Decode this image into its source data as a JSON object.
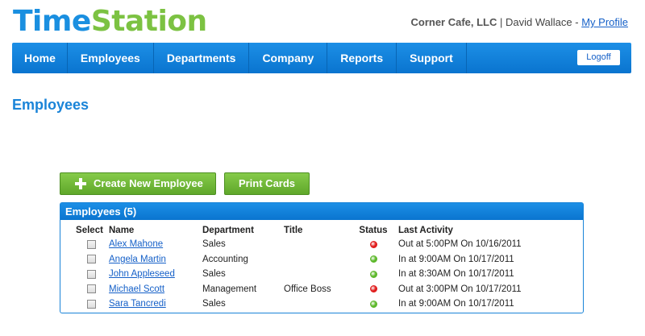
{
  "logo": {
    "part1": "Time",
    "part2": "Station"
  },
  "account": {
    "company": "Corner Cafe, LLC",
    "separator": "|",
    "user": "David Wallace -",
    "profile_link": "My Profile"
  },
  "nav": {
    "items": [
      "Home",
      "Employees",
      "Departments",
      "Company",
      "Reports",
      "Support"
    ],
    "logoff": "Logoff"
  },
  "page": {
    "title": "Employees"
  },
  "actions": {
    "create": "Create New Employee",
    "print": "Print Cards"
  },
  "panel": {
    "title": "Employees (5)"
  },
  "table": {
    "headers": {
      "select": "Select",
      "name": "Name",
      "department": "Department",
      "title": "Title",
      "status": "Status",
      "last": "Last Activity"
    },
    "rows": [
      {
        "name": "Alex Mahone",
        "department": "Sales",
        "title": "",
        "status": "out",
        "status_color": "#e01b1b",
        "last": "Out at 5:00PM On 10/16/2011"
      },
      {
        "name": "Angela Martin",
        "department": "Accounting",
        "title": "",
        "status": "in",
        "status_color": "#5cb82a",
        "last": "In at 9:00AM On 10/17/2011"
      },
      {
        "name": "John Appleseed",
        "department": "Sales",
        "title": "",
        "status": "in",
        "status_color": "#5cb82a",
        "last": "In at 8:30AM On 10/17/2011"
      },
      {
        "name": "Michael Scott",
        "department": "Management",
        "title": "Office Boss",
        "status": "out",
        "status_color": "#e01b1b",
        "last": "Out at 3:00PM On 10/17/2011"
      },
      {
        "name": "Sara Tancredi",
        "department": "Sales",
        "title": "",
        "status": "in",
        "status_color": "#5cb82a",
        "last": "In at 9:00AM On 10/17/2011"
      }
    ]
  }
}
